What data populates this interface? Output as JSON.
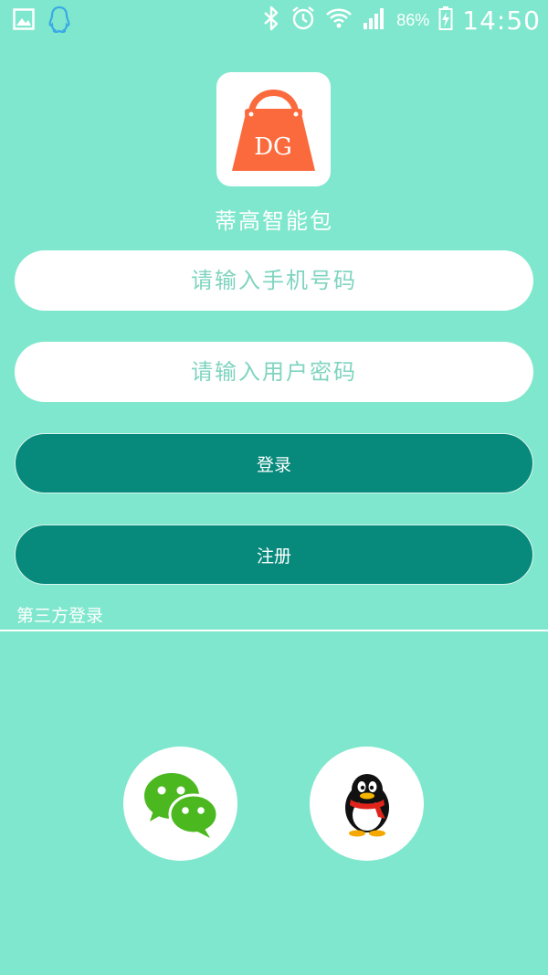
{
  "status_bar": {
    "left_icons": [
      "image-icon",
      "qq-notification-icon"
    ],
    "right_icons": [
      "bluetooth-icon",
      "alarm-icon",
      "wifi-icon",
      "signal-icon",
      "battery-charging-icon"
    ],
    "battery_percent": "86%",
    "time": "14:50"
  },
  "logo": {
    "icon": "handbag-logo-icon",
    "monogram": "DG",
    "bag_color": "#fb6a3c"
  },
  "app_name": "蒂高智能包",
  "form": {
    "phone_placeholder": "请输入手机号码",
    "password_placeholder": "请输入用户密码",
    "login_label": "登录",
    "register_label": "注册"
  },
  "third_party": {
    "label": "第三方登录",
    "providers": [
      "wechat-icon",
      "qq-icon"
    ]
  },
  "colors": {
    "background": "#7fe7cd",
    "button": "#078a7c",
    "placeholder": "#7fd4c0",
    "wechat_green": "#4bb81f",
    "qq_scarf": "#e0241b"
  }
}
